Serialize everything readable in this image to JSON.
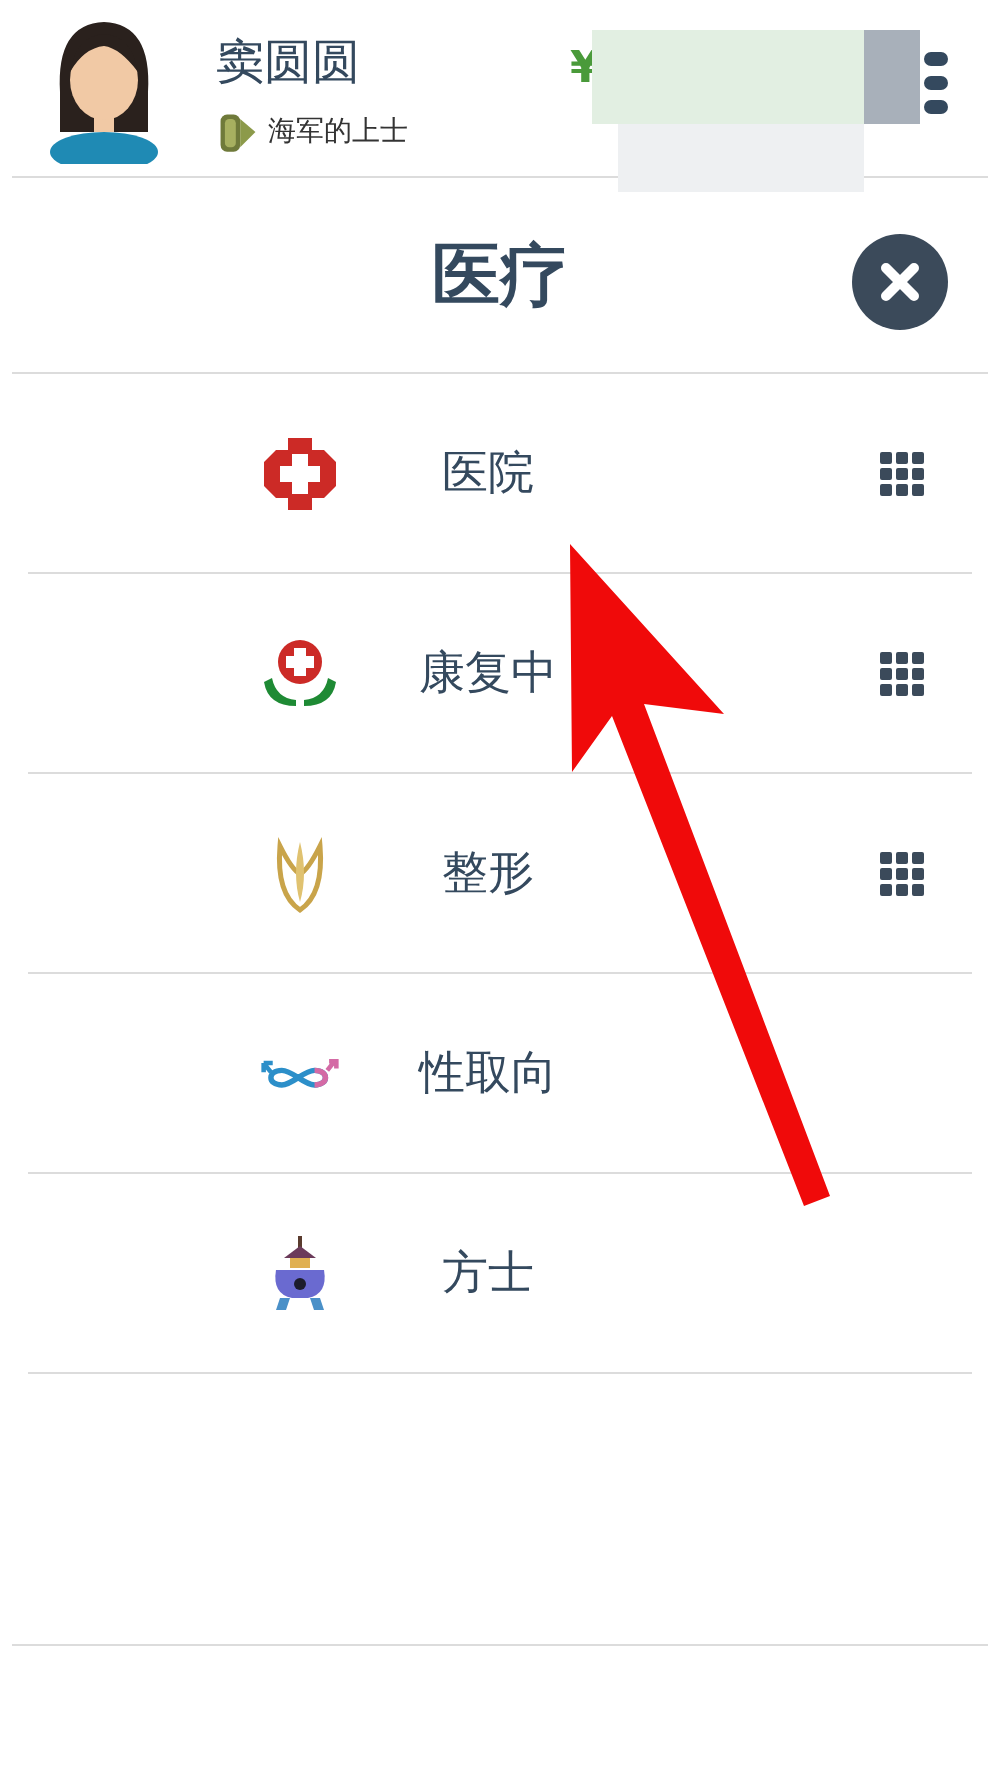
{
  "user": {
    "name": "窦圆圆",
    "rank": "海军的上士",
    "currency": "¥"
  },
  "panel": {
    "title": "医疗"
  },
  "items": [
    {
      "label": "医院",
      "kind": "red-cross",
      "has_grid": true
    },
    {
      "label": "康复中",
      "kind": "cross-hands",
      "has_grid": true
    },
    {
      "label": "整形",
      "kind": "tulip",
      "has_grid": true
    },
    {
      "label": "性取向",
      "kind": "gender",
      "has_grid": false
    },
    {
      "label": "方士",
      "kind": "burner",
      "has_grid": false
    }
  ]
}
